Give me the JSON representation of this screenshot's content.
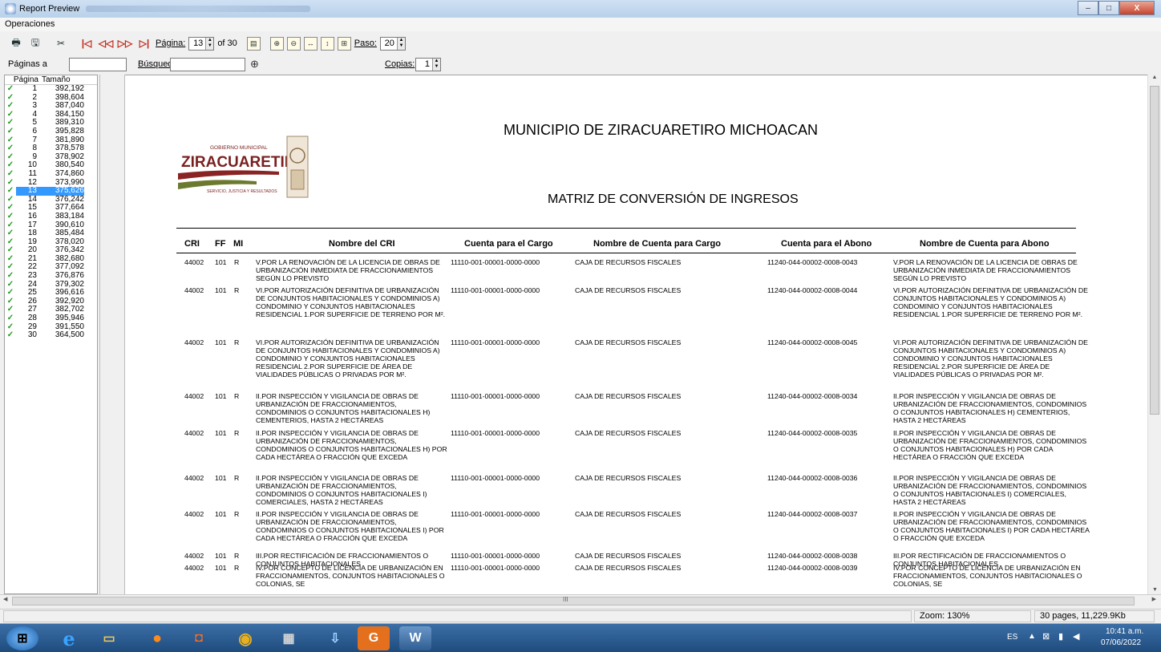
{
  "window": {
    "title": "Report Preview",
    "buttons": [
      "–",
      "□",
      "X"
    ]
  },
  "menu": {
    "operaciones": "Operaciones"
  },
  "toolbar": {
    "pagina_label": "Página:",
    "pagina_value": "13",
    "of_label": "of 30",
    "paso_label": "Paso:",
    "paso_value": "20",
    "paginas_a_label": "Páginas a",
    "busqueda_label": "Búsqued",
    "copias_label": "Copias:",
    "copias_value": "1"
  },
  "pages_panel": {
    "header_page": "Página",
    "header_size": "Tamaño",
    "selected": 13,
    "rows": [
      {
        "page": "1",
        "size": "392,192"
      },
      {
        "page": "2",
        "size": "398,604"
      },
      {
        "page": "3",
        "size": "387,040"
      },
      {
        "page": "4",
        "size": "384,150"
      },
      {
        "page": "5",
        "size": "389,310"
      },
      {
        "page": "6",
        "size": "395,828"
      },
      {
        "page": "7",
        "size": "381,890"
      },
      {
        "page": "8",
        "size": "378,578"
      },
      {
        "page": "9",
        "size": "378,902"
      },
      {
        "page": "10",
        "size": "380,540"
      },
      {
        "page": "11",
        "size": "374,860"
      },
      {
        "page": "12",
        "size": "373,990"
      },
      {
        "page": "13",
        "size": "375,626"
      },
      {
        "page": "14",
        "size": "376,242"
      },
      {
        "page": "15",
        "size": "377,664"
      },
      {
        "page": "16",
        "size": "383,184"
      },
      {
        "page": "17",
        "size": "390,610"
      },
      {
        "page": "18",
        "size": "385,484"
      },
      {
        "page": "19",
        "size": "378,020"
      },
      {
        "page": "20",
        "size": "376,342"
      },
      {
        "page": "21",
        "size": "382,680"
      },
      {
        "page": "22",
        "size": "377,092"
      },
      {
        "page": "23",
        "size": "376,876"
      },
      {
        "page": "24",
        "size": "379,302"
      },
      {
        "page": "25",
        "size": "396,616"
      },
      {
        "page": "26",
        "size": "392,920"
      },
      {
        "page": "27",
        "size": "382,702"
      },
      {
        "page": "28",
        "size": "395,946"
      },
      {
        "page": "29",
        "size": "391,550"
      },
      {
        "page": "30",
        "size": "364,500"
      }
    ]
  },
  "report": {
    "title": "MUNICIPIO DE ZIRACUARETIRO MICHOACAN",
    "subtitle": "MATRIZ DE CONVERSIÓN DE INGRESOS",
    "logo": {
      "small": "GOBIERNO MUNICIPAL",
      "name": "ZIRACUARETIRO",
      "tagline": "SERVICIO, JUSTICIA Y RESULTADOS"
    },
    "columns": [
      "CRI",
      "FF",
      "MI",
      "Nombre del CRI",
      "Cuenta para el Cargo",
      "Nombre de Cuenta para Cargo",
      "Cuenta para el Abono",
      "Nombre de Cuenta para Abono"
    ],
    "rows": [
      {
        "cri": "44002",
        "ff": "101",
        "mi": "R",
        "nombre": "V.POR LA RENOVACIÓN DE LA LICENCIA DE OBRAS DE URBANIZACIÓN INMEDIATA DE FRACCIONAMIENTOS SEGÚN LO PREVISTO",
        "cargo": "11110-001-00001-0000-0000",
        "ncargo": "CAJA DE RECURSOS FISCALES",
        "abono": "11240-044-00002-0008-0043",
        "nabono": "V.POR LA RENOVACIÓN DE LA LICENCIA DE OBRAS DE URBANIZACIÓN INMEDIATA DE FRACCIONAMIENTOS SEGÚN LO PREVISTO"
      },
      {
        "cri": "44002",
        "ff": "101",
        "mi": "R",
        "nombre": "VI.POR AUTORIZACIÓN DEFINITIVA DE URBANIZACIÓN DE CONJUNTOS HABITACIONALES Y CONDOMINIOS A) CONDOMINIO Y CONJUNTOS HABITACIONALES RESIDENCIAL 1.POR SUPERFICIE DE TERRENO POR M².",
        "cargo": "11110-001-00001-0000-0000",
        "ncargo": "CAJA DE RECURSOS FISCALES",
        "abono": "11240-044-00002-0008-0044",
        "nabono": "VI.POR AUTORIZACIÓN DEFINITIVA DE URBANIZACIÓN DE CONJUNTOS HABITACIONALES Y CONDOMINIOS A) CONDOMINIO Y CONJUNTOS HABITACIONALES RESIDENCIAL 1.POR SUPERFICIE DE TERRENO POR M²."
      },
      {
        "cri": "44002",
        "ff": "101",
        "mi": "R",
        "nombre": "VI.POR AUTORIZACIÓN DEFINITIVA DE URBANIZACIÓN DE CONJUNTOS HABITACIONALES Y CONDOMINIOS A) CONDOMINIO Y CONJUNTOS HABITACIONALES RESIDENCIAL 2.POR SUPERFICIE DE ÁREA DE VIALIDADES PÚBLICAS O PRIVADAS POR M².",
        "cargo": "11110-001-00001-0000-0000",
        "ncargo": "CAJA DE RECURSOS FISCALES",
        "abono": "11240-044-00002-0008-0045",
        "nabono": "VI.POR AUTORIZACIÓN DEFINITIVA DE URBANIZACIÓN DE CONJUNTOS HABITACIONALES Y CONDOMINIOS A) CONDOMINIO Y CONJUNTOS HABITACIONALES RESIDENCIAL 2.POR SUPERFICIE DE ÁREA DE VIALIDADES PÚBLICAS O PRIVADAS POR M²."
      },
      {
        "cri": "44002",
        "ff": "101",
        "mi": "R",
        "nombre": "II.POR INSPECCIÓN Y VIGILANCIA DE OBRAS DE URBANIZACIÓN DE FRACCIONAMIENTOS, CONDOMINIOS O CONJUNTOS HABITACIONALES H) CEMENTERIOS, HASTA 2 HECTÁREAS",
        "cargo": "11110-001-00001-0000-0000",
        "ncargo": "CAJA DE RECURSOS FISCALES",
        "abono": "11240-044-00002-0008-0034",
        "nabono": "II.POR INSPECCIÓN Y VIGILANCIA DE OBRAS DE URBANIZACIÓN DE FRACCIONAMIENTOS, CONDOMINIOS O CONJUNTOS HABITACIONALES H) CEMENTERIOS, HASTA 2 HECTÁREAS"
      },
      {
        "cri": "44002",
        "ff": "101",
        "mi": "R",
        "nombre": "II.POR INSPECCIÓN Y VIGILANCIA DE OBRAS DE URBANIZACIÓN DE FRACCIONAMIENTOS, CONDOMINIOS O CONJUNTOS HABITACIONALES H) POR CADA HECTÁREA O FRACCIÓN QUE EXCEDA",
        "cargo": "11110-001-00001-0000-0000",
        "ncargo": "CAJA DE RECURSOS FISCALES",
        "abono": "11240-044-00002-0008-0035",
        "nabono": "II.POR INSPECCIÓN Y VIGILANCIA DE OBRAS DE URBANIZACIÓN DE FRACCIONAMIENTOS, CONDOMINIOS O CONJUNTOS HABITACIONALES H) POR CADA HECTÁREA O FRACCIÓN QUE EXCEDA"
      },
      {
        "cri": "44002",
        "ff": "101",
        "mi": "R",
        "nombre": "II.POR INSPECCIÓN Y VIGILANCIA DE OBRAS DE URBANIZACIÓN DE FRACCIONAMIENTOS, CONDOMINIOS O CONJUNTOS HABITACIONALES I) COMERCIALES, HASTA 2 HECTÁREAS",
        "cargo": "11110-001-00001-0000-0000",
        "ncargo": "CAJA DE RECURSOS FISCALES",
        "abono": "11240-044-00002-0008-0036",
        "nabono": "II.POR INSPECCIÓN Y VIGILANCIA DE OBRAS DE URBANIZACIÓN DE FRACCIONAMIENTOS, CONDOMINIOS O CONJUNTOS HABITACIONALES I) COMERCIALES, HASTA 2 HECTÁREAS"
      },
      {
        "cri": "44002",
        "ff": "101",
        "mi": "R",
        "nombre": "II.POR INSPECCIÓN Y VIGILANCIA DE OBRAS DE URBANIZACIÓN DE FRACCIONAMIENTOS, CONDOMINIOS O CONJUNTOS HABITACIONALES I) POR CADA HECTÁREA O FRACCIÓN QUE EXCEDA",
        "cargo": "11110-001-00001-0000-0000",
        "ncargo": "CAJA DE RECURSOS FISCALES",
        "abono": "11240-044-00002-0008-0037",
        "nabono": "II.POR INSPECCIÓN Y VIGILANCIA DE OBRAS DE URBANIZACIÓN DE FRACCIONAMIENTOS, CONDOMINIOS O CONJUNTOS HABITACIONALES I) POR CADA HECTÁREA O FRACCIÓN QUE EXCEDA"
      },
      {
        "cri": "44002",
        "ff": "101",
        "mi": "R",
        "nombre": "III.POR RECTIFICACIÓN DE FRACCIONAMIENTOS O CONJUNTOS HABITACIONALES",
        "cargo": "11110-001-00001-0000-0000",
        "ncargo": "CAJA DE RECURSOS FISCALES",
        "abono": "11240-044-00002-0008-0038",
        "nabono": "III.POR RECTIFICACIÓN DE FRACCIONAMIENTOS O CONJUNTOS HABITACIONALES"
      },
      {
        "cri": "44002",
        "ff": "101",
        "mi": "R",
        "nombre": "IV.POR CONCEPTO DE LICENCIA DE URBANIZACIÓN EN FRACCIONAMIENTOS, CONJUNTOS HABITACIONALES O COLONIAS, SE",
        "cargo": "11110-001-00001-0000-0000",
        "ncargo": "CAJA DE RECURSOS FISCALES",
        "abono": "11240-044-00002-0008-0039",
        "nabono": "IV.POR CONCEPTO DE LICENCIA DE URBANIZACIÓN EN FRACCIONAMIENTOS, CONJUNTOS HABITACIONALES O COLONIAS, SE"
      }
    ]
  },
  "hscroll_mark": "III",
  "status": {
    "zoom": "Zoom: 130%",
    "pages": "30 pages, 11,229.9Kb"
  },
  "taskbar": {
    "lang": "ES",
    "time": "10:41 a.m.",
    "date": "07/06/2022"
  }
}
